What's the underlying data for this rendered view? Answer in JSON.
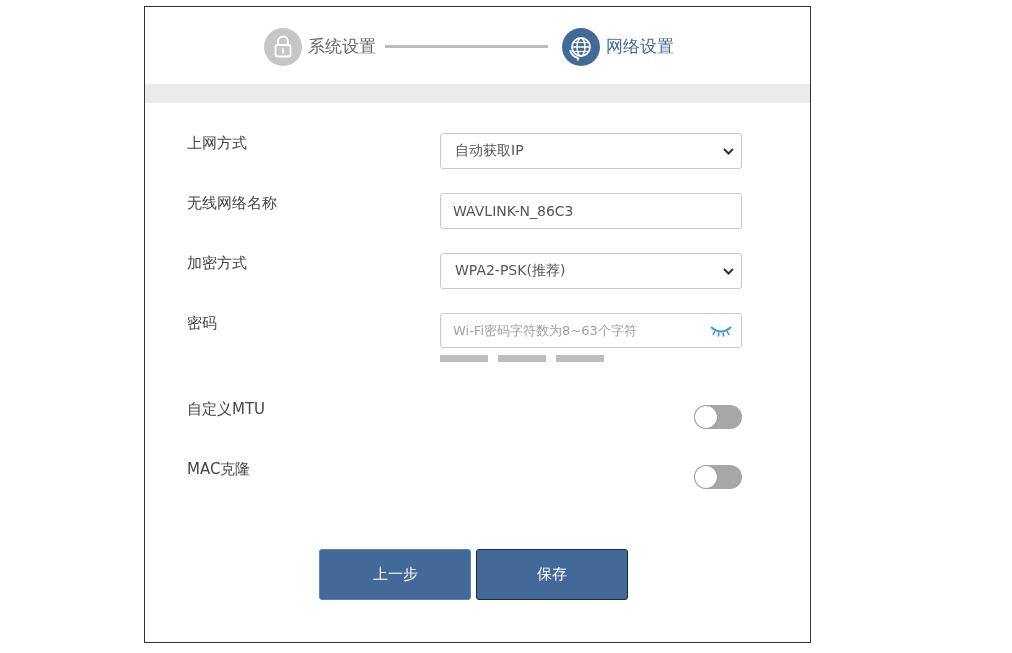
{
  "steps": [
    {
      "label": "系统设置",
      "selected": false
    },
    {
      "label": "网络设置",
      "selected": true
    }
  ],
  "form": {
    "rows": [
      {
        "kind": "select",
        "label": "上网方式",
        "value": "自动获取IP"
      },
      {
        "kind": "text",
        "label": "无线网络名称",
        "value": "WAVLINK-N_86C3"
      },
      {
        "kind": "select",
        "label": "加密方式",
        "value": "WPA2-PSK(推荐)"
      },
      {
        "kind": "password",
        "label": "密码",
        "placeholder": "Wi-Fi密码字符数为8~63个字符",
        "strength_bars": [
          {
            "on": false
          },
          {
            "on": false
          },
          {
            "on": false
          }
        ]
      },
      {
        "kind": "toggle",
        "label": "自定义MTU",
        "on": false
      },
      {
        "kind": "toggle",
        "label": "MAC克隆",
        "on": false
      }
    ]
  },
  "buttons": [
    {
      "label": "上一步",
      "focused": false
    },
    {
      "label": "保存",
      "focused": true
    }
  ]
}
